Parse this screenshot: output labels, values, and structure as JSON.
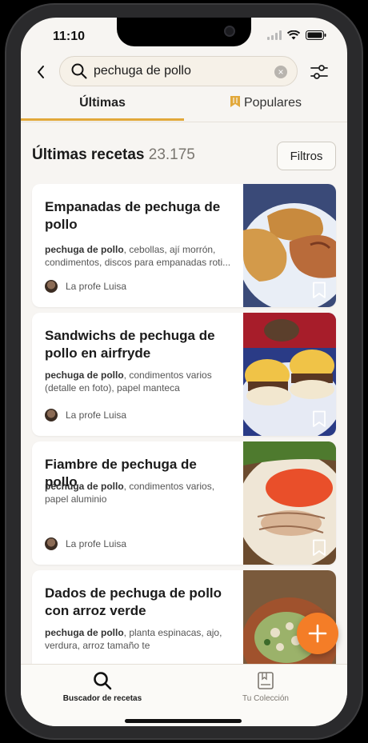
{
  "status": {
    "time": "11:10"
  },
  "search": {
    "value": "pechuga de pollo",
    "placeholder": ""
  },
  "tabs": {
    "latest": "Últimas",
    "popular": "Populares"
  },
  "section": {
    "title": "Últimas recetas",
    "count": "23.175",
    "filter_label": "Filtros"
  },
  "recipes": [
    {
      "title": "Empanadas de pechuga de pollo",
      "ingredients_bold": "pechuga de pollo",
      "ingredients_rest": ", cebollas, ají morrón, condimentos, discos para empanadas roti...",
      "author": "La profe Luisa"
    },
    {
      "title": "Sandwichs de pechuga de pollo en airfryde",
      "ingredients_bold": "pechuga de pollo",
      "ingredients_rest": ", condimentos varios (detalle en foto), papel manteca",
      "author": "La profe Luisa"
    },
    {
      "title": "Fiambre de pechuga de pollo",
      "ingredients_bold": "pechuga de pollo",
      "ingredients_rest": ", condimentos varios, papel aluminio",
      "author": "La profe Luisa"
    },
    {
      "title": "Dados de pechuga de pollo con arroz verde",
      "ingredients_bold": "pechuga de pollo",
      "ingredients_rest": ", planta espinacas, ajo, verdura, arroz tamaño te",
      "author": ""
    }
  ],
  "tabbar": {
    "search_label": "Buscador de recetas",
    "collection_label": "Tu Colección"
  },
  "colors": {
    "accent": "#e2a83a",
    "fab": "#f47d27",
    "background": "#f7f5f2"
  },
  "icons": [
    "back-arrow-icon",
    "search-icon",
    "clear-icon",
    "sliders-icon",
    "bookmark-icon",
    "plus-icon",
    "collection-icon"
  ]
}
